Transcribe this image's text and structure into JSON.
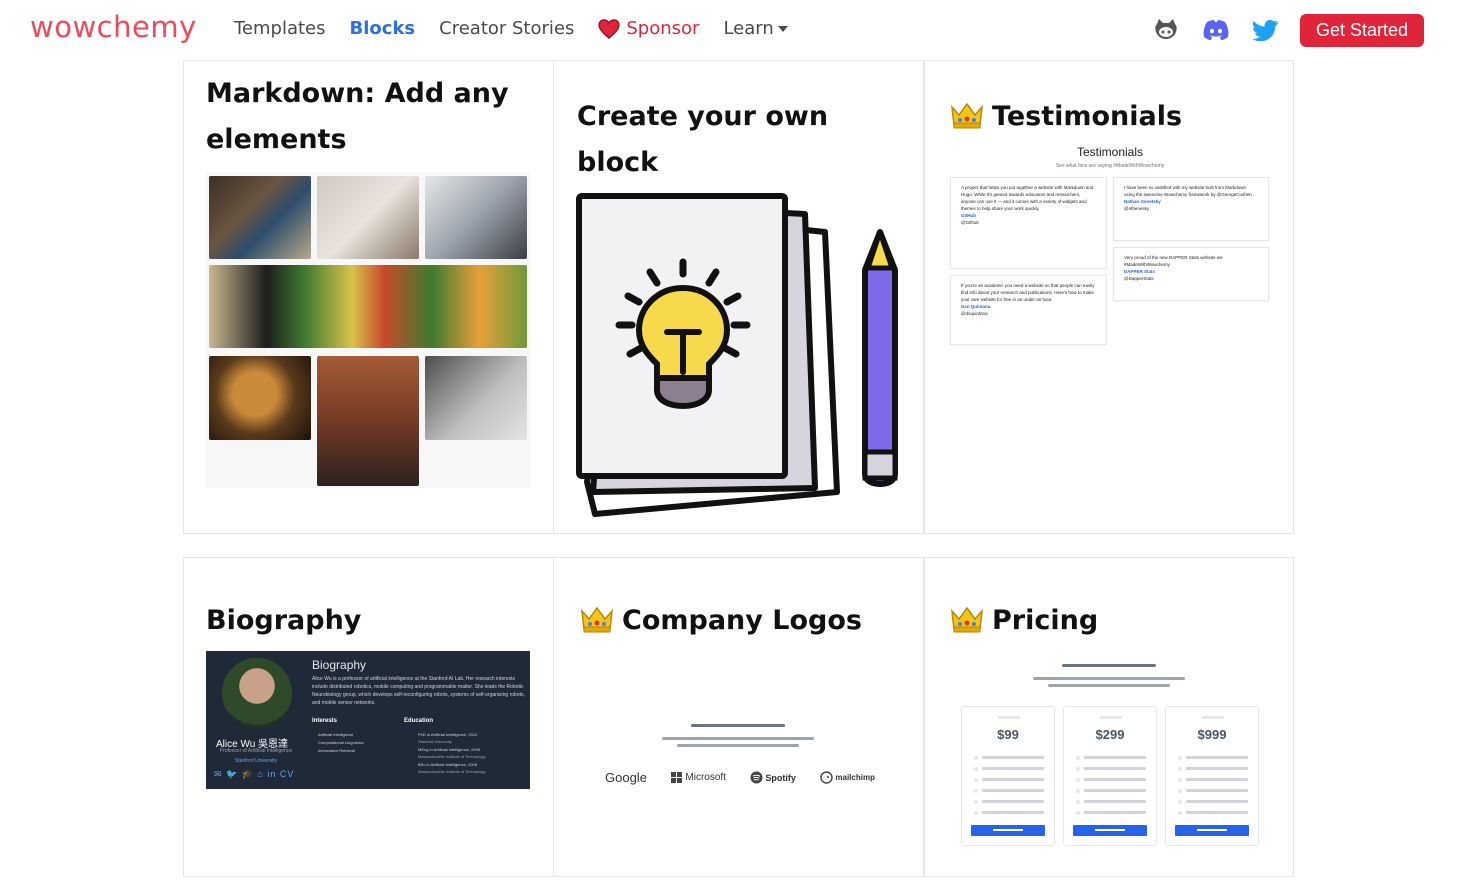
{
  "nav": {
    "brand": "wowchemy",
    "links": [
      "Templates",
      "Blocks",
      "Creator Stories",
      "Sponsor",
      "Learn"
    ],
    "active": "Blocks",
    "cta": "Get Started",
    "icons": [
      "github-icon",
      "discord-icon",
      "twitter-icon"
    ]
  },
  "cards": {
    "markdown": {
      "title": "Markdown: Add any elements"
    },
    "custom": {
      "title": "Create your own block"
    },
    "testimonials": {
      "title": "Testimonials"
    },
    "biography": {
      "title": "Biography"
    },
    "logos": {
      "title": "Company Logos"
    },
    "pricing": {
      "title": "Pricing"
    }
  },
  "testimonials_preview": {
    "heading": "Testimonials",
    "subheading": "See what fans are saying #MadeWithWowchemy",
    "quotes": [
      {
        "text": "A project that helps you put together a website with Markdown and Hugo. While it's geared towards educators and researchers, anyone can use it — and it comes with a variety of widgets and themes to help share your work quickly",
        "author": "GitHub",
        "handle": "@Github"
      },
      {
        "text": "If you're an academic you need a website so that people can easily find info about your research and publications. Here's how to make your own website for free in an under an hour.",
        "author": "Dan Quintana",
        "handle": "@dsquintana"
      },
      {
        "text": "I have been so satisfied with my website built from Markdown using the awesome Wowchemy framework by @GeorgeCushen",
        "author": "Nathan Genetsky",
        "handle": "@ntbenesky"
      },
      {
        "text": "Very proud of the new DAPPER Stats website we #MadeWithWowchemy",
        "author": "DAPPER Stats",
        "handle": "@DapperStats"
      }
    ]
  },
  "biography_preview": {
    "heading": "Biography",
    "name": "Alice Wu 吳恩達",
    "role": "Professor of Artificial Intelligence",
    "university": "Stanford University",
    "socials": "✉ 🐦 🎓 ⌂ in CV",
    "paragraph": "Alice Wu is a professor of artificial intelligence at the Stanford AI Lab. Her research interests include distributed robotics, mobile computing and programmable matter. She leads the Robotic Neurobiology group, which develops self-reconfiguring robots, systems of self-organizing robots, and mobile sensor networks.",
    "interests_label": "Interests",
    "interests": [
      "Artificial Intelligence",
      "Computational Linguistics",
      "Information Retrieval"
    ],
    "education_label": "Education",
    "education": [
      {
        "degree": "PhD in Artificial Intelligence, 2012",
        "school": "Stanford University"
      },
      {
        "degree": "MEng in Artificial Intelligence, 2009",
        "school": "Massachusetts Institute of Technology"
      },
      {
        "degree": "BSc in Artificial Intelligence, 2008",
        "school": "Massachusetts Institute of Technology"
      }
    ]
  },
  "logos_preview": [
    "Google",
    "Microsoft",
    "Spotify",
    "mailchimp"
  ],
  "pricing_preview": [
    "$99",
    "$299",
    "$999"
  ],
  "colors": {
    "brand": "#ef4a5a",
    "accent": "#2f6fe0",
    "cta": "#e0243a"
  }
}
